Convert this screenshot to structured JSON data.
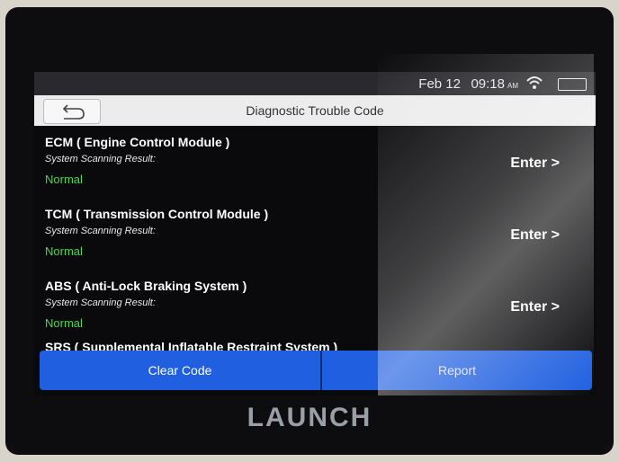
{
  "status_bar": {
    "date": "Feb 12",
    "time": "09:18",
    "ampm": "AM"
  },
  "header": {
    "title": "Diagnostic Trouble Code",
    "back_icon": "back-arrow-icon"
  },
  "systems": [
    {
      "name": "ECM ( Engine Control Module )",
      "scan_label": "System Scanning Result:",
      "result": "Normal",
      "action": "Enter >"
    },
    {
      "name": "TCM ( Transmission Control Module )",
      "scan_label": "System Scanning Result:",
      "result": "Normal",
      "action": "Enter >"
    },
    {
      "name": "ABS ( Anti-Lock Braking System )",
      "scan_label": "System Scanning Result:",
      "result": "Normal",
      "action": "Enter >"
    },
    {
      "name": "SRS ( Supplemental Inflatable Restraint System )"
    }
  ],
  "footer": {
    "clear_label": "Clear Code",
    "report_label": "Report"
  },
  "brand": "LAUNCH",
  "colors": {
    "button": "#1f5fe0",
    "normal": "#4dd84a",
    "titlebar": "#ececec"
  }
}
